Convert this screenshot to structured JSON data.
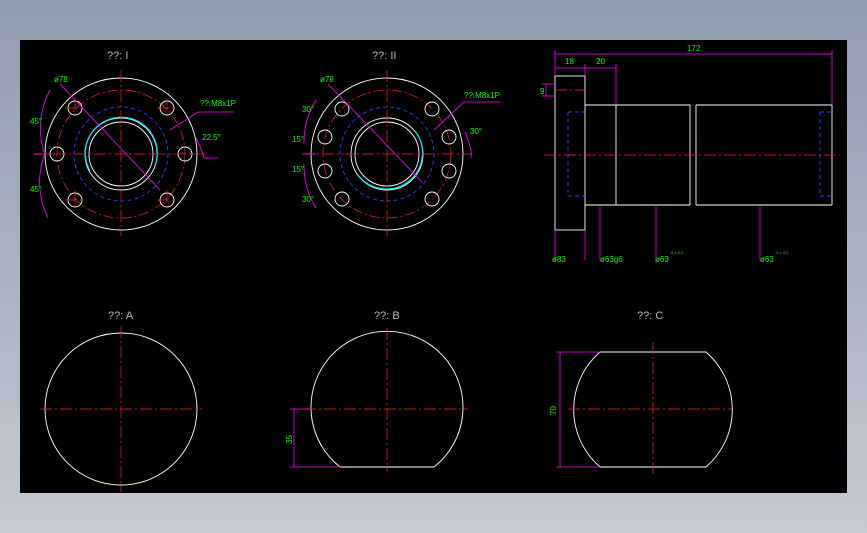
{
  "views": {
    "view_1_title": "??: I",
    "view_2_title": "??: II",
    "view_a_title": "??: A",
    "view_b_title": "??: B",
    "view_c_title": "??: C"
  },
  "dims": {
    "v1_bolt_circle": "ø78",
    "v1_thread": "??:M8x1P",
    "v1_angle_top": "45°",
    "v1_angle_bottom": "45°",
    "v1_angle_right": "22.5°",
    "v2_bolt_circle": "ø78",
    "v2_thread": "??:M8x1P",
    "v2_angle_30_tl": "30°",
    "v2_angle_15_t": "15°",
    "v2_angle_15_b": "15°",
    "v2_angle_30_bl": "30°",
    "v2_angle_30_r": "30°",
    "side_total_length": "172",
    "side_flange_thickness": "18",
    "side_step_length": "20",
    "side_small_offset": "9",
    "side_d1": "ø83",
    "side_d2": "ø63g6",
    "side_d3": "ø63",
    "side_d3_tol": "-0.1 -0.2",
    "side_d4": "ø63",
    "side_d4_tol": "-0.1 -0.2",
    "b_height": "35",
    "c_height": "70"
  },
  "colors": {
    "background": "#000000",
    "outline": "#ffffff",
    "centerline": "#ff2020",
    "dimension": "#ff00ff",
    "dim_text": "#00ff00",
    "hidden": "#2a40ff",
    "title_text": "#b9b9b9",
    "thread_arc": "#00e5ff"
  }
}
